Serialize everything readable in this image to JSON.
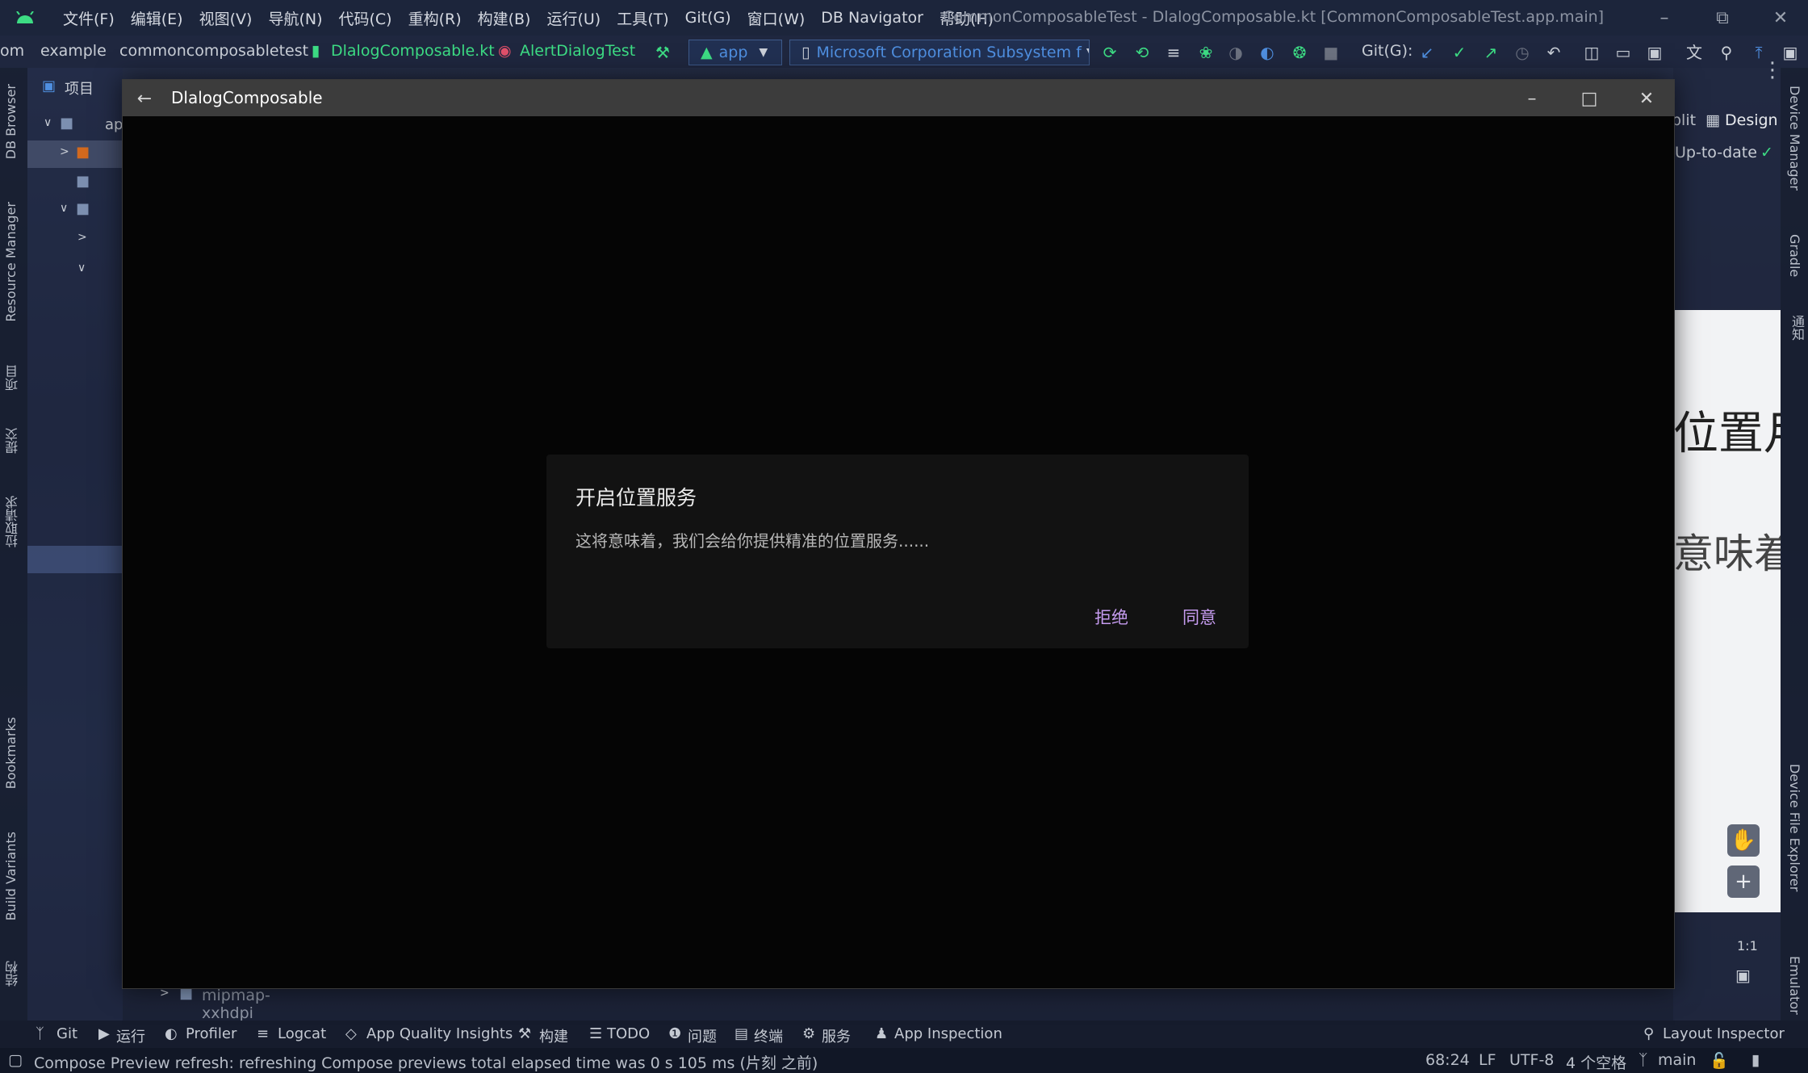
{
  "menubar": {
    "items": [
      "文件(F)",
      "编辑(E)",
      "视图(V)",
      "导航(N)",
      "代码(C)",
      "重构(R)",
      "构建(B)",
      "运行(U)",
      "工具(T)",
      "Git(G)",
      "窗口(W)",
      "DB Navigator",
      "帮助(H)"
    ],
    "window_title": "CommonComposableTest - DlalogComposable.kt [CommonComposableTest.app.main]"
  },
  "toolbar": {
    "breadcrumb": [
      "om",
      "example",
      "commoncomposabletest",
      "DlalogComposable.kt",
      "AlertDialogTest"
    ],
    "run_config": "app",
    "device": "Microsoft Corporation Subsystem f",
    "git_label": "Git(G):"
  },
  "left_tabs": [
    "DB Browser",
    "Resource Manager",
    "项目",
    "提交",
    "拉取请求",
    "Bookmarks",
    "Build Variants",
    "结构"
  ],
  "right_tabs": [
    "Device Manager",
    "Gradle",
    "通知",
    "Device File Explorer",
    "Emulator"
  ],
  "project_panel": {
    "header": "项目",
    "root": "ap",
    "bottom_item": "mipmap-xxhdpi"
  },
  "design_panel": {
    "split_label": "plit",
    "design_label": "Design",
    "status": "Up-to-date",
    "preview_text_1": "位置月",
    "preview_text_2": "意味着",
    "zoom_ratio": "1:1"
  },
  "modal": {
    "title": "DlalogComposable",
    "dialog": {
      "title": "开启位置服务",
      "text": "这将意味着，我们会给你提供精准的位置服务......",
      "dismiss": "拒绝",
      "confirm": "同意"
    }
  },
  "bottom_tools": [
    "Git",
    "运行",
    "Profiler",
    "Logcat",
    "App Quality Insights",
    "构建",
    "TODO",
    "问题",
    "终端",
    "服务",
    "App Inspection"
  ],
  "layout_inspector": "Layout Inspector",
  "status_bar": {
    "message": "Compose Preview refresh: refreshing Compose previews total elapsed time was 0 s 105 ms (片刻 之前)",
    "position": "68:24",
    "line_sep": "LF",
    "encoding": "UTF-8",
    "indent": "4 个空格",
    "branch": "main"
  },
  "colors": {
    "accent_purple": "#c69cf0",
    "android_green": "#3ddc84",
    "link_blue": "#4f8fe0"
  }
}
